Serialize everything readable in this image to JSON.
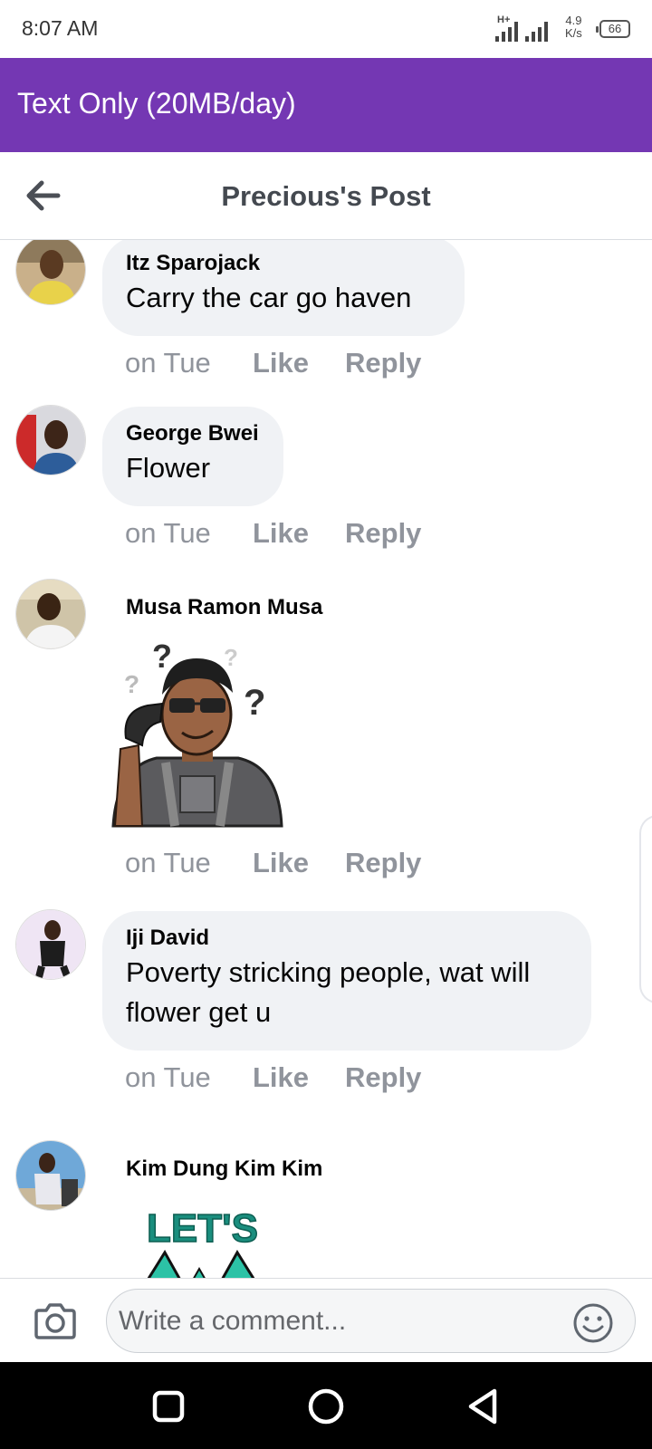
{
  "status_bar": {
    "time": "8:07 AM",
    "network_type": "H+",
    "speed_value": "4.9",
    "speed_unit": "K/s",
    "battery": "66"
  },
  "banner": {
    "text": "Text Only (20MB/day)",
    "color": "#7437b3"
  },
  "header": {
    "title": "Precious's Post",
    "back_icon": "arrow-left-icon"
  },
  "comments": [
    {
      "author": "Itz Sparojack",
      "text": "Carry the car go haven",
      "time": "on Tue",
      "like": "Like",
      "reply": "Reply"
    },
    {
      "author": "George Bwei",
      "text": "Flower",
      "time": "on Tue",
      "like": "Like",
      "reply": "Reply"
    },
    {
      "author": "Musa Ramon Musa",
      "sticker": "confused-man-sticker",
      "time": "on Tue",
      "like": "Like",
      "reply": "Reply"
    },
    {
      "author": "Iji David",
      "text_line1": "Poverty stricking people, wat will",
      "text_line2": "flower get u",
      "time": "on Tue",
      "like": "Like",
      "reply": "Reply"
    },
    {
      "author": "Kim Dung Kim Kim",
      "sticker": "lets-go-sticker",
      "sticker_text": "LET'S"
    }
  ],
  "composer": {
    "placeholder": "Write a comment...",
    "camera_icon": "camera-icon",
    "emoji_icon": "smiley-icon"
  },
  "navbar": {
    "icons": [
      "square-icon",
      "circle-icon",
      "triangle-back-icon"
    ]
  }
}
